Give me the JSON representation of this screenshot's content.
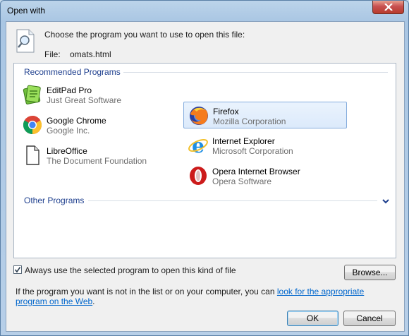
{
  "window": {
    "title": "Open with"
  },
  "header": {
    "prompt": "Choose the program you want to use to open this file:",
    "file_label": "File:",
    "file_name": "omats.html"
  },
  "recommended": {
    "label": "Recommended Programs",
    "programs": [
      {
        "name": "EditPad Pro",
        "vendor": "Just Great Software",
        "icon": "editpad-icon",
        "selected": false
      },
      {
        "name": "Firefox",
        "vendor": "Mozilla Corporation",
        "icon": "firefox-icon",
        "selected": true
      },
      {
        "name": "Google Chrome",
        "vendor": "Google Inc.",
        "icon": "chrome-icon",
        "selected": false
      },
      {
        "name": "Internet Explorer",
        "vendor": "Microsoft Corporation",
        "icon": "internet-explorer-icon",
        "selected": false
      },
      {
        "name": "LibreOffice",
        "vendor": "The Document Foundation",
        "icon": "libreoffice-icon",
        "selected": false
      },
      {
        "name": "Opera Internet Browser",
        "vendor": "Opera Software",
        "icon": "opera-icon",
        "selected": false
      }
    ]
  },
  "other": {
    "label": "Other Programs",
    "expanded": false
  },
  "always_use": {
    "label": "Always use the selected program to open this kind of file",
    "checked": true
  },
  "buttons": {
    "browse": "Browse...",
    "ok": "OK",
    "cancel": "Cancel"
  },
  "info": {
    "text": "If the program you want is not in the list or on your computer, you can ",
    "link": "look for the appropriate program on the Web",
    "end": "."
  },
  "colors": {
    "accent": "#1e3f8e",
    "link": "#0066cc",
    "selection": "#dceafb",
    "close": "#c75050"
  }
}
